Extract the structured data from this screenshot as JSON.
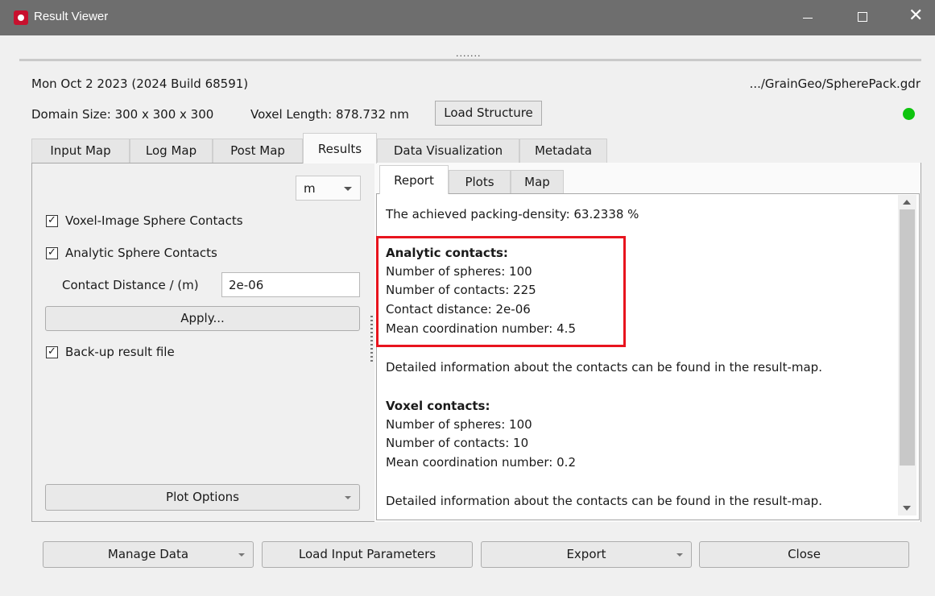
{
  "window": {
    "title": "Result Viewer"
  },
  "header": {
    "date_build": "Mon Oct 2 2023 (2024 Build 68591)",
    "file_path": ".../GrainGeo/SpherePack.gdr",
    "domain_size": "Domain Size: 300 x 300 x 300",
    "voxel_length": "Voxel Length: 878.732 nm",
    "load_structure": "Load Structure",
    "status_color": "#0ec40e"
  },
  "tabs": [
    {
      "label": "Input Map"
    },
    {
      "label": "Log Map"
    },
    {
      "label": "Post Map"
    },
    {
      "label": "Results"
    },
    {
      "label": "Data Visualization"
    },
    {
      "label": "Metadata"
    }
  ],
  "active_tab": "Results",
  "left": {
    "unit": "m",
    "voxel_contacts_label": "Voxel-Image Sphere Contacts",
    "analytic_contacts_label": "Analytic Sphere Contacts",
    "contact_distance_label": "Contact Distance / (m)",
    "contact_distance_value": "2e-06",
    "apply_label": "Apply...",
    "backup_label": "Back-up result file",
    "plot_options_label": "Plot Options",
    "check_glyph": "✓"
  },
  "subtabs": [
    {
      "label": "Report"
    },
    {
      "label": "Plots"
    },
    {
      "label": "Map"
    }
  ],
  "report": {
    "packing_density": "The achieved packing-density: 63.2338 %",
    "analytic_heading": "Analytic contacts:",
    "analytic_spheres": "Number of spheres: 100",
    "analytic_contacts": "Number of contacts: 225",
    "analytic_distance": "Contact distance: 2e-06",
    "analytic_coordination": "Mean coordination number: 4.5",
    "analytic_detail": "Detailed information about the contacts can be found in the result-map.",
    "voxel_heading": "Voxel contacts:",
    "voxel_spheres": "Number of spheres: 100",
    "voxel_contacts": "Number of contacts: 10",
    "voxel_coordination": "Mean coordination number: 0.2",
    "voxel_detail": "Detailed information about the contacts can be found in the result-map."
  },
  "footer": {
    "manage_data": "Manage Data",
    "load_input_parameters": "Load Input Parameters",
    "export": "Export",
    "close": "Close"
  },
  "highlight_color": "#e8141e"
}
